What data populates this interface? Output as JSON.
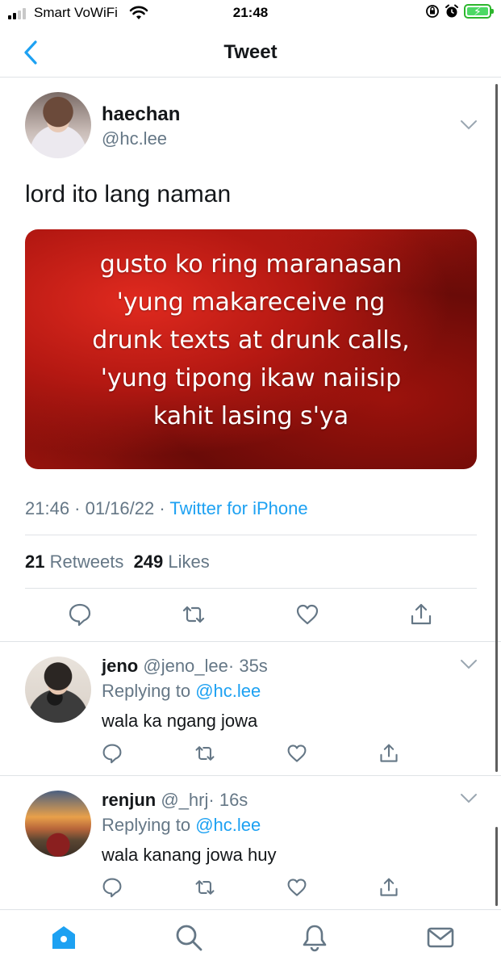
{
  "status_bar": {
    "carrier": "Smart VoWiFi",
    "time": "21:48"
  },
  "nav": {
    "title": "Tweet"
  },
  "tweet": {
    "author_name": "haechan",
    "author_handle": "@hc.lee",
    "text": "lord ito lang naman",
    "image_text_lines": [
      "gusto ko ring maranasan",
      "'yung makareceive ng",
      "drunk texts at drunk calls,",
      "'yung tipong ikaw naiisip",
      "kahit lasing s'ya"
    ],
    "timestamp": "21:46 · 01/16/22 · ",
    "source": "Twitter for iPhone",
    "retweet_count": "21",
    "retweet_label": "Retweets",
    "like_count": "249",
    "like_label": "Likes"
  },
  "replies": [
    {
      "name": "jeno",
      "handle": "@jeno_lee",
      "time": "· 35s",
      "replying_label": "Replying to",
      "replying_handle": "@hc.lee",
      "text": "wala ka ngang jowa"
    },
    {
      "name": "renjun",
      "handle": "@_hrj",
      "time": "· 16s",
      "replying_label": "Replying to",
      "replying_handle": "@hc.lee",
      "text": "wala kanang jowa huy"
    }
  ],
  "colors": {
    "accent": "#1da1f2",
    "secondary_text": "#657786",
    "primary_text": "#14171a",
    "divider": "#dfe3e6"
  },
  "icons": [
    "back-chevron-icon",
    "wifi-icon",
    "battery-icon",
    "reply-icon",
    "retweet-icon",
    "like-icon",
    "share-icon",
    "home-icon",
    "search-icon",
    "notifications-icon",
    "messages-icon"
  ]
}
